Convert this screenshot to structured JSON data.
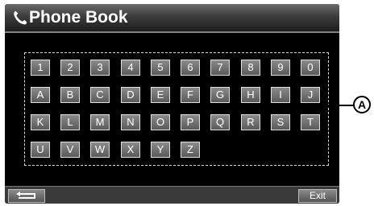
{
  "header": {
    "title": "Phone Book",
    "icon": "phone-icon"
  },
  "keys": {
    "row1": [
      "1",
      "2",
      "3",
      "4",
      "5",
      "6",
      "7",
      "8",
      "9",
      "0"
    ],
    "row2": [
      "A",
      "B",
      "C",
      "D",
      "E",
      "F",
      "G",
      "H",
      "I",
      "J"
    ],
    "row3": [
      "K",
      "L",
      "M",
      "N",
      "O",
      "P",
      "Q",
      "R",
      "S",
      "T"
    ],
    "row4": [
      "U",
      "V",
      "W",
      "X",
      "Y",
      "Z"
    ]
  },
  "footer": {
    "back_icon": "return-icon",
    "exit_label": "Exit"
  },
  "callout": {
    "label": "A"
  }
}
